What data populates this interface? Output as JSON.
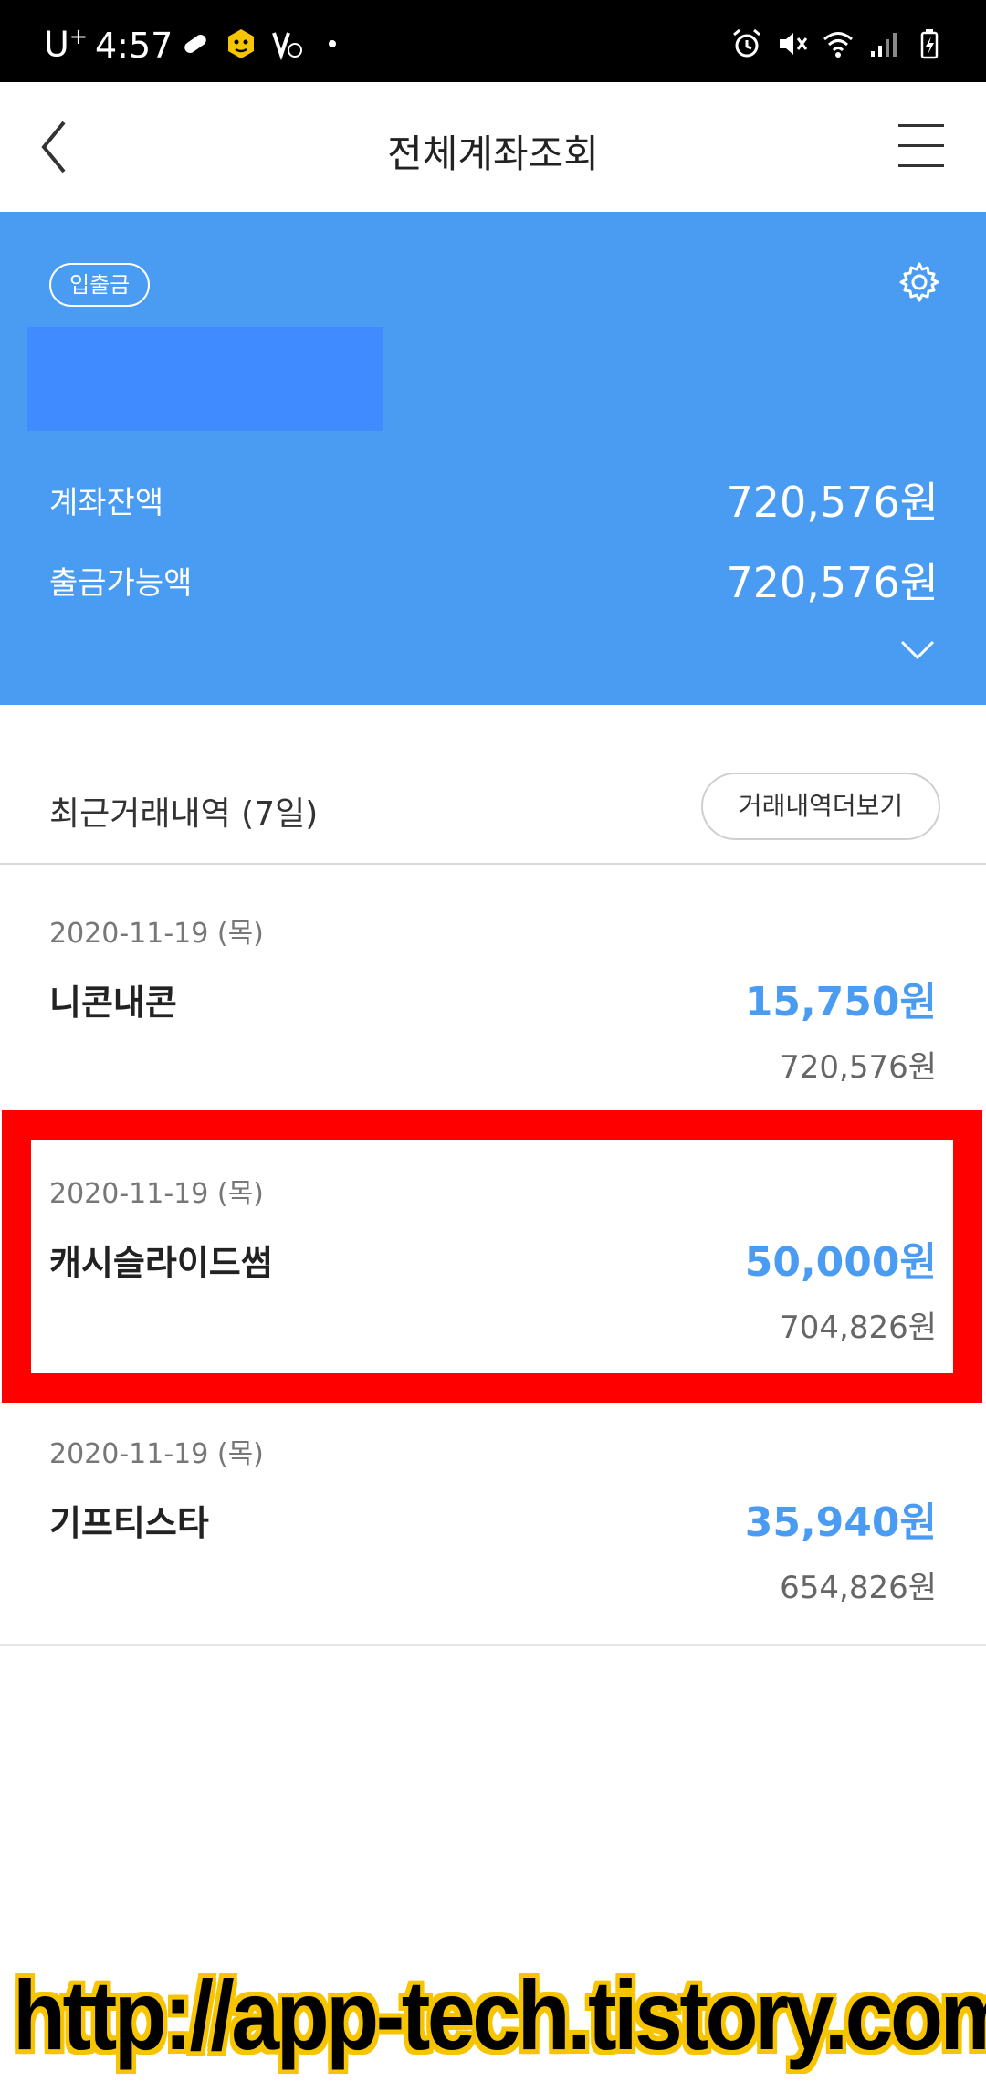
{
  "status_bar": {
    "carrier": "U",
    "carrier_sup": "+",
    "time": "4:57",
    "left_icons": [
      "pill-icon",
      "bee-icon",
      "volte-icon",
      "dot-icon"
    ],
    "right_icons": [
      "alarm-icon",
      "mute-icon",
      "wifi-icon",
      "signal-icon",
      "battery-icon"
    ]
  },
  "header": {
    "title": "전체계좌조회"
  },
  "account": {
    "badge": "입출금",
    "balance_label": "계좌잔액",
    "balance_value": "720,576원",
    "withdrawable_label": "출금가능액",
    "withdrawable_value": "720,576원",
    "card_color": "#4a9cf3",
    "mask_color": "#3f8bff"
  },
  "recent": {
    "title": "최근거래내역 (7일)",
    "more_button": "거래내역더보기"
  },
  "transactions": [
    {
      "date": "2020-11-19 (목)",
      "name": "니콘내콘",
      "amount": "15,750원",
      "balance": "720,576원"
    },
    {
      "date": "2020-11-19 (목)",
      "name": "캐시슬라이드썸",
      "amount": "50,000원",
      "balance": "704,826원"
    },
    {
      "date": "2020-11-19 (목)",
      "name": "기프티스타",
      "amount": "35,940원",
      "balance": "654,826원"
    }
  ],
  "highlight_color": "#ff0000",
  "watermark": "http://app-tech.tistory.com"
}
